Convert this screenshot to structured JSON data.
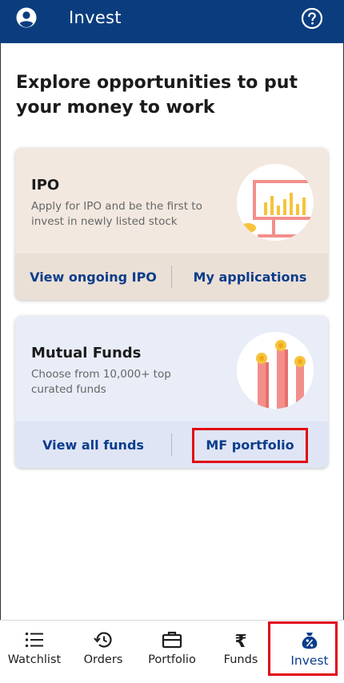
{
  "header": {
    "title": "Invest",
    "user_icon": "account-circle-icon",
    "help_icon": "help-circle-icon",
    "bg_color": "#0b3d7e"
  },
  "heading": "Explore opportunities to put your money to work",
  "cards": [
    {
      "title": "IPO",
      "description": "Apply for IPO and be the first to invest in newly listed stock",
      "actions": [
        "View ongoing IPO",
        "My applications"
      ]
    },
    {
      "title": "Mutual Funds",
      "description": "Choose from 10,000+ top curated funds",
      "actions": [
        "View all funds",
        "MF portfolio"
      ]
    }
  ],
  "bottom_nav": [
    {
      "label": "Watchlist",
      "icon": "watchlist-icon",
      "active": false
    },
    {
      "label": "Orders",
      "icon": "history-icon",
      "active": false
    },
    {
      "label": "Portfolio",
      "icon": "briefcase-icon",
      "active": false
    },
    {
      "label": "Funds",
      "icon": "rupee-icon",
      "active": false
    },
    {
      "label": "Invest",
      "icon": "money-bag-icon",
      "active": true
    }
  ],
  "colors": {
    "accent": "#0b3d8c",
    "highlight": "#e30613"
  }
}
